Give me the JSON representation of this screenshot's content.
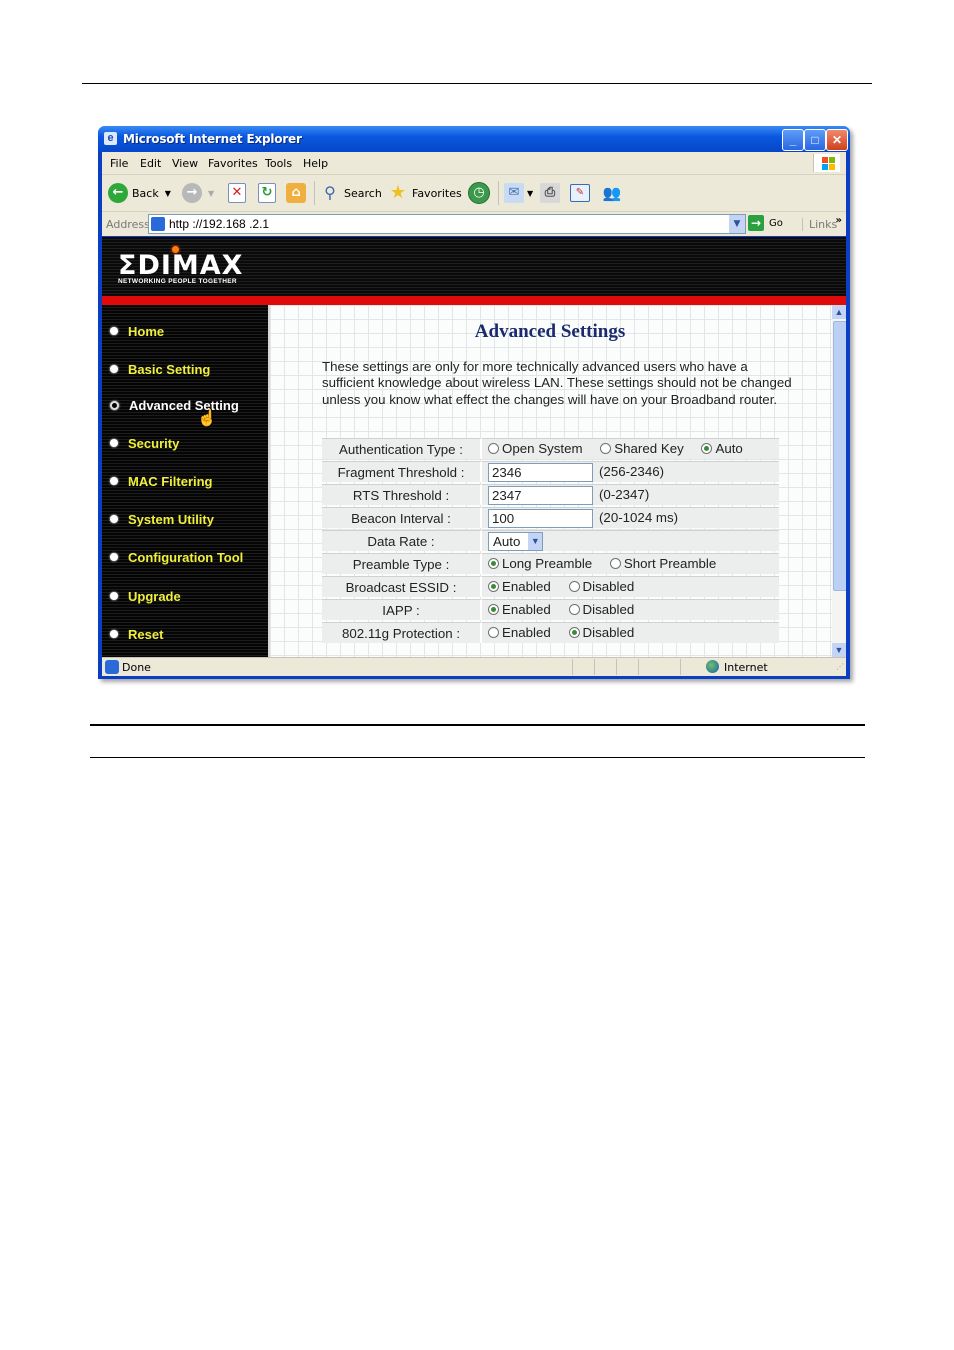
{
  "window": {
    "title": "Microsoft Internet Explorer",
    "controls": {
      "minimize": "_",
      "maximize": "□",
      "close": "✕"
    }
  },
  "menubar": [
    "File",
    "Edit",
    "View",
    "Favorites",
    "Tools",
    "Help"
  ],
  "toolbar": {
    "back": "Back",
    "search": "Search",
    "favorites": "Favorites"
  },
  "addressbar": {
    "label": "Address",
    "url": "http ://192.168 .2.1",
    "go": "Go",
    "links": "Links",
    "chevron": "»"
  },
  "banner": {
    "logo": "ΣDIMAX",
    "tagline": "NETWORKING PEOPLE TOGETHER"
  },
  "sidebar": {
    "items": [
      {
        "label": "Home",
        "active": false
      },
      {
        "label": "Basic Setting",
        "active": false
      },
      {
        "label": "Advanced Setting",
        "active": true
      },
      {
        "label": "Security",
        "active": false
      },
      {
        "label": "MAC Filtering",
        "active": false
      },
      {
        "label": "System Utility",
        "active": false
      },
      {
        "label": "Configuration Tool",
        "active": false
      },
      {
        "label": "Upgrade",
        "active": false
      },
      {
        "label": "Reset",
        "active": false
      }
    ]
  },
  "main": {
    "title": "Advanced Settings",
    "intro": "These settings are only for more technically advanced users who have a sufficient knowledge about wireless LAN. These settings should not be changed unless you know what effect the changes will have on your Broadband router.",
    "settings": {
      "auth_type": {
        "label": "Authentication Type :",
        "options": [
          "Open System",
          "Shared Key",
          "Auto"
        ],
        "selected": "Auto"
      },
      "fragment_threshold": {
        "label": "Fragment Threshold :",
        "value": "2346",
        "hint": "(256-2346)"
      },
      "rts_threshold": {
        "label": "RTS Threshold :",
        "value": "2347",
        "hint": "(0-2347)"
      },
      "beacon_interval": {
        "label": "Beacon Interval :",
        "value": "100",
        "hint": "(20-1024 ms)"
      },
      "data_rate": {
        "label": "Data Rate :",
        "value": "Auto"
      },
      "preamble_type": {
        "label": "Preamble Type :",
        "options": [
          "Long Preamble",
          "Short Preamble"
        ],
        "selected": "Long Preamble"
      },
      "broadcast_essid": {
        "label": "Broadcast ESSID :",
        "options": [
          "Enabled",
          "Disabled"
        ],
        "selected": "Enabled"
      },
      "iapp": {
        "label": "IAPP :",
        "options": [
          "Enabled",
          "Disabled"
        ],
        "selected": "Enabled"
      },
      "g_protection": {
        "label": "802.11g Protection :",
        "options": [
          "Enabled",
          "Disabled"
        ],
        "selected": "Disabled"
      }
    }
  },
  "statusbar": {
    "status": "Done",
    "zone": "Internet"
  }
}
